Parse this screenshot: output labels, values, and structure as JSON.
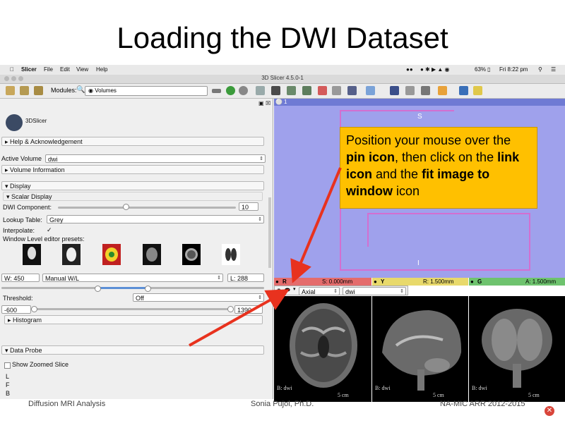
{
  "slide": {
    "title": "Loading the DWI Dataset",
    "footer_left": "Diffusion MRI Analysis",
    "footer_center": "Sonia Pujol, Ph.D.",
    "footer_right": "NA-MIC ARR 2012-2015"
  },
  "menubar": {
    "app": "Slicer",
    "items": [
      "File",
      "Edit",
      "View",
      "Help"
    ],
    "battery": "63%",
    "clock": "Fri 8:22 pm"
  },
  "window": {
    "title": "3D Slicer 4.5.0-1"
  },
  "toolbar": {
    "modules_label": "Modules:",
    "module_selected": "Volumes"
  },
  "left_panel": {
    "logo_text": "3DSlicer",
    "help_section": "Help & Acknowledgement",
    "active_volume_label": "Active Volume",
    "active_volume_value": "dwi",
    "volume_info_section": "Volume Information",
    "display_section": "Display",
    "scalar_display_section": "Scalar Display",
    "dwi_component_label": "DWI Component:",
    "dwi_component_value": "10",
    "dwi_component_fraction": 0.38,
    "lookup_table_label": "Lookup Table:",
    "lookup_table_value": "Grey",
    "interpolate_label": "Interpolate:",
    "interpolate_checked": "✓",
    "presets_label": "Window Level editor presets:",
    "window_value": "W: 450",
    "window_mode": "Manual W/L",
    "level_value": "L: 288",
    "threshold_label": "Threshold:",
    "threshold_value": "Off",
    "threshold_min": "-600",
    "threshold_max": "1390",
    "histogram_section": "Histogram",
    "data_probe_section": "Data Probe",
    "show_zoomed_slice": "Show Zoomed Slice",
    "probe_letters": [
      "L",
      "F",
      "B"
    ]
  },
  "view3d": {
    "tab_number": "1",
    "label_top": "S",
    "label_bottom": "I"
  },
  "slice_bars": {
    "red": {
      "letter": "R",
      "value": "S: 0.000mm"
    },
    "yellow": {
      "letter": "Y",
      "value": "R: 1.500mm"
    },
    "green": {
      "letter": "G",
      "value": "A: 1.500mm"
    }
  },
  "slice_controls": {
    "orientation": "Axial",
    "volume": "dwi"
  },
  "slice_views": {
    "bottom_label": "B: dwi",
    "scale": "5 cm"
  },
  "callout": {
    "t1": "Position your mouse over the ",
    "b1": "pin icon",
    "t2": ", then click on the ",
    "b2": "link icon",
    "t3": " and the ",
    "b3": "fit image to window",
    "t4": " icon"
  },
  "colors": {
    "arrow": "#e8321e",
    "callout_bg": "#ffc000",
    "view3d_bg": "#9fa1ec",
    "slider_blue": "#5b8fd6"
  }
}
